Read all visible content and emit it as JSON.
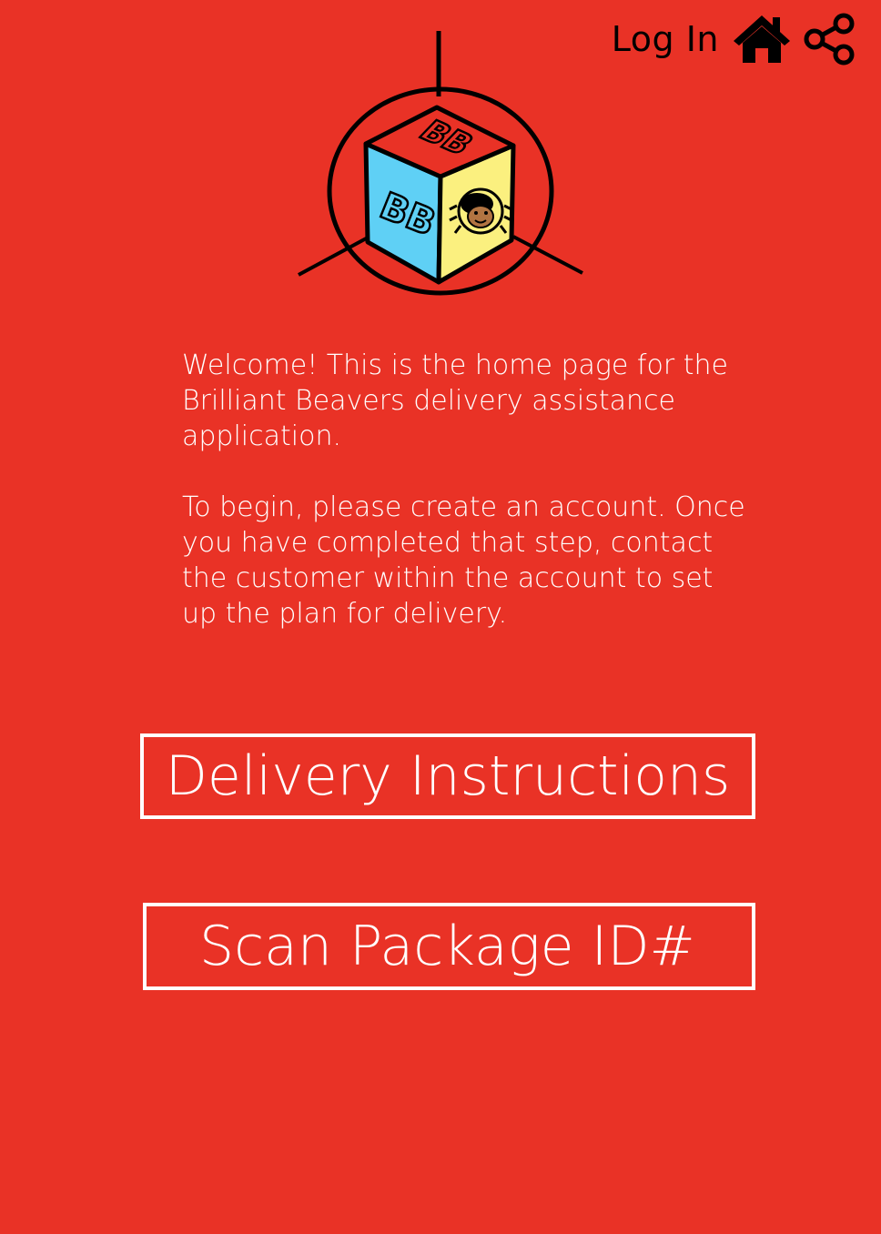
{
  "header": {
    "login_label": "Log In",
    "home_icon": "home-icon",
    "share_icon": "share-icon"
  },
  "logo": {
    "top_face_text": "BB",
    "left_face_text": "BB",
    "colors": {
      "top_face": "#e93226",
      "left_face": "#5fd0f5",
      "right_face": "#fbf07f",
      "outline": "#000000"
    }
  },
  "intro": {
    "paragraph_1": "Welcome! This is the home page for the Brilliant Beavers delivery assistance application.",
    "paragraph_2": "To begin, please create an account. Once you have completed that step, contact the customer within the account to set up the plan for delivery."
  },
  "actions": {
    "delivery_instructions_label": "Delivery Instructions",
    "scan_package_label": "Scan Package ID#"
  },
  "colors": {
    "background": "#e93226",
    "text_primary": "#ffffff",
    "header_text": "#000000"
  }
}
